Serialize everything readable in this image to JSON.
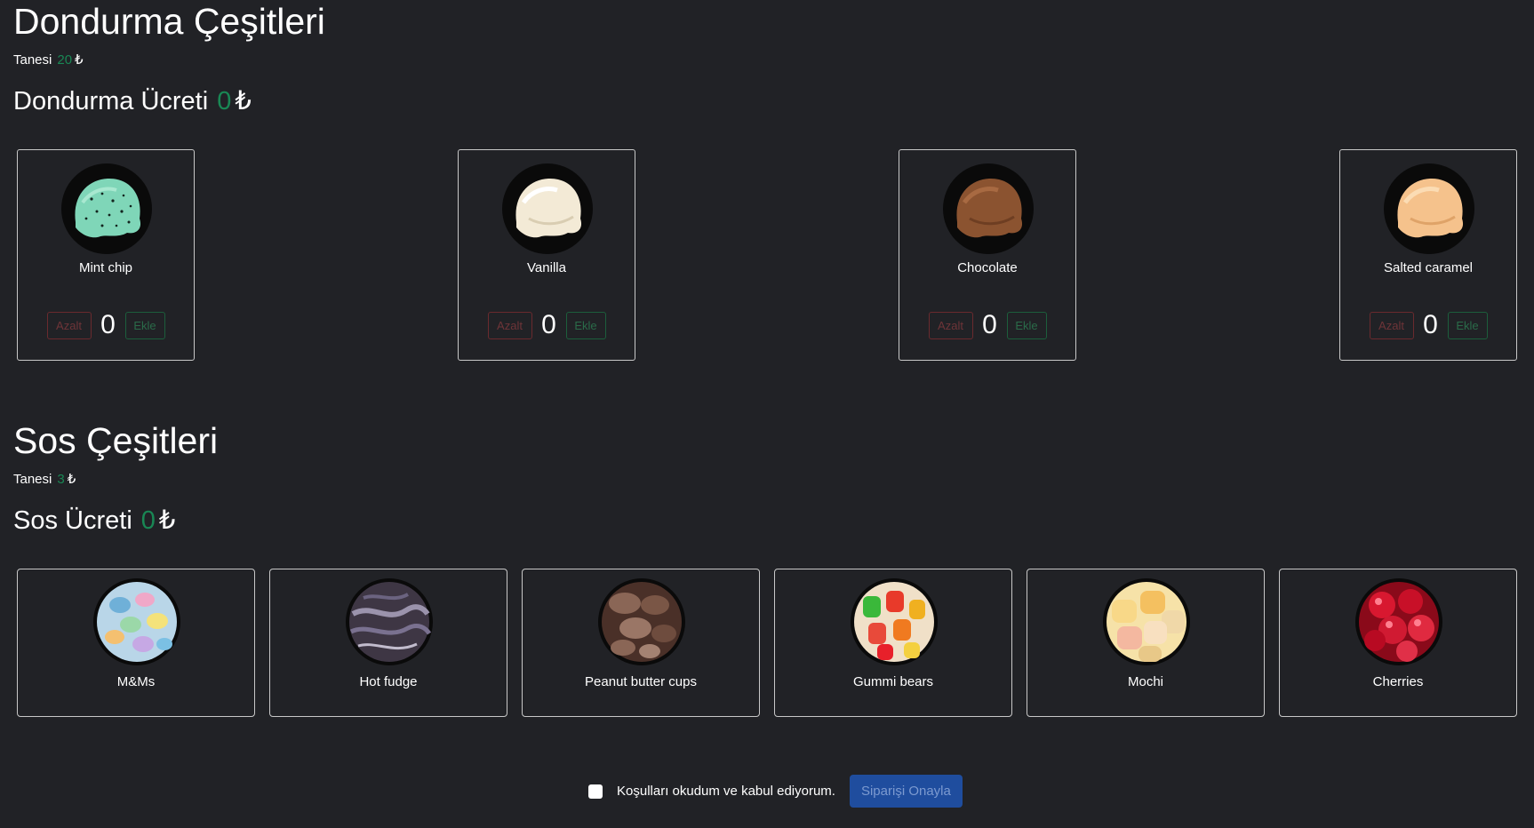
{
  "icecream": {
    "title": "Dondurma Çeşitleri",
    "unit_label": "Tanesi",
    "unit_price": "20",
    "currency": "₺",
    "fee_label": "Dondurma Ücreti",
    "fee_value": "0",
    "decrease_label": "Azalt",
    "add_label": "Ekle",
    "items": [
      {
        "name": "Mint chip",
        "count": "0",
        "color": "#6fd0b0"
      },
      {
        "name": "Vanilla",
        "count": "0",
        "color": "#f1e7d2"
      },
      {
        "name": "Chocolate",
        "count": "0",
        "color": "#8a5230"
      },
      {
        "name": "Salted caramel",
        "count": "0",
        "color": "#f4c08a"
      }
    ]
  },
  "sauce": {
    "title": "Sos Çeşitleri",
    "unit_label": "Tanesi",
    "unit_price": "3",
    "currency": "₺",
    "fee_label": "Sos Ücreti",
    "fee_value": "0",
    "items": [
      {
        "name": "M&Ms",
        "color": "#7bb6d4"
      },
      {
        "name": "Hot fudge",
        "color": "#5a4a5c"
      },
      {
        "name": "Peanut butter cups",
        "color": "#6b4a3c"
      },
      {
        "name": "Gummi bears",
        "color": "#e8503a"
      },
      {
        "name": "Mochi",
        "color": "#f0c878"
      },
      {
        "name": "Cherries",
        "color": "#c8102e"
      }
    ]
  },
  "footer": {
    "terms_label": "Koşulları okudum ve kabul ediyorum.",
    "confirm_label": "Siparişi Onayla"
  }
}
